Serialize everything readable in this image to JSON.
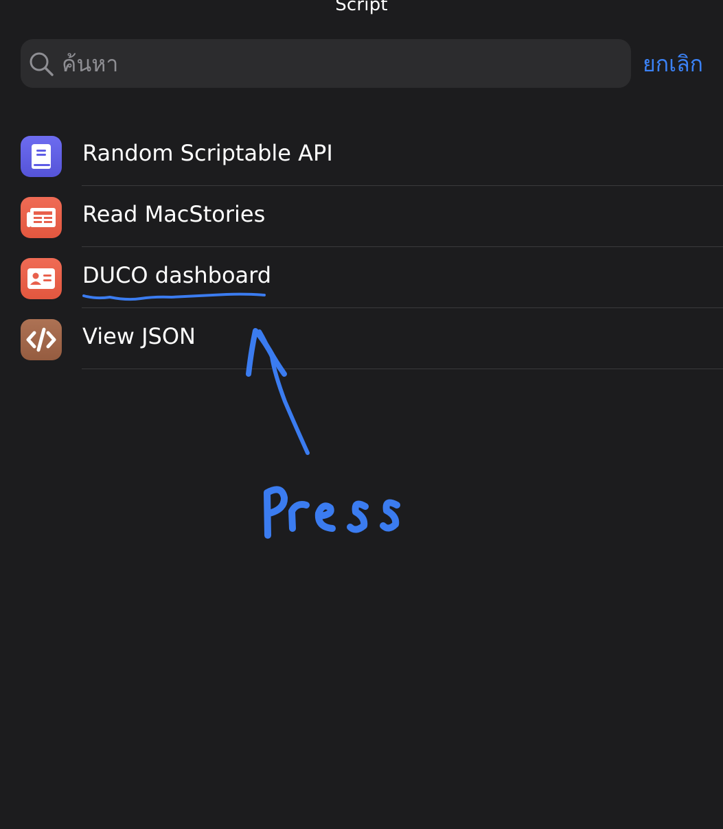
{
  "header": {
    "title": "Script"
  },
  "search": {
    "placeholder": "ค้นหา",
    "value": "",
    "icon": "search-icon",
    "cancel_label": "ยกเลิก"
  },
  "scripts": [
    {
      "label": "Random Scriptable API",
      "icon": "book-icon",
      "color": "#5e5ce6"
    },
    {
      "label": "Read MacStories",
      "icon": "newspaper-icon",
      "color": "#e8604c"
    },
    {
      "label": "DUCO dashboard",
      "icon": "id-card-icon",
      "color": "#e8604c"
    },
    {
      "label": "View JSON",
      "icon": "code-icon",
      "color": "#a2674a"
    }
  ],
  "annotation": {
    "color": "#3b7cf0",
    "handwritten_text": "Press"
  }
}
